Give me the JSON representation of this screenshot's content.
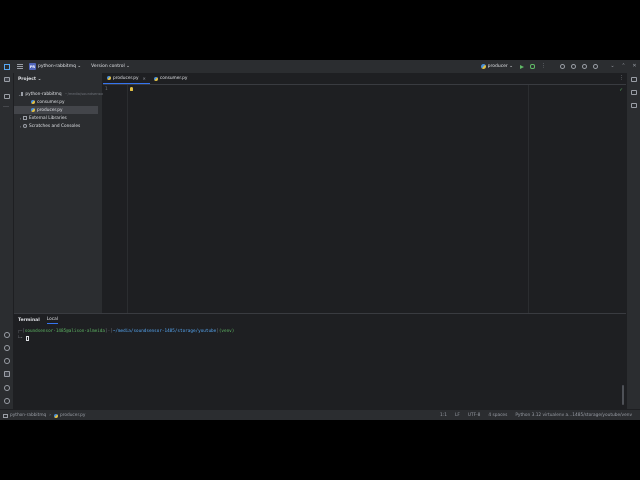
{
  "titlebar": {
    "project_badge": "PR",
    "project_name": "python-rabbitmq",
    "vcs_label": "Version control",
    "run_config": "producer"
  },
  "project_panel": {
    "title": "Project",
    "tree": [
      {
        "label": "python-rabbitmq",
        "path": "~/media/soundsensor-1485",
        "kind": "folder",
        "expanded": true,
        "depth": 0
      },
      {
        "label": "consumer.py",
        "kind": "python",
        "depth": 1
      },
      {
        "label": "producer.py",
        "kind": "python",
        "depth": 1,
        "selected": true
      },
      {
        "label": "External Libraries",
        "kind": "library",
        "depth": 0
      },
      {
        "label": "Scratches and Consoles",
        "kind": "scratch",
        "depth": 0
      }
    ]
  },
  "editor": {
    "tabs": [
      {
        "label": "producer.py",
        "active": true
      },
      {
        "label": "consumer.py",
        "active": false
      }
    ],
    "line_numbers": [
      "1"
    ]
  },
  "terminal": {
    "title": "Terminal",
    "tab": "Local",
    "prompt_user": "soundsensor-1485@alison-almeida",
    "prompt_path": "~/media/soundsensor-1485/storage/youtube",
    "prompt_env": "(venv)",
    "prompt_bracket_open": "[",
    "prompt_bracket_mid": "]-[",
    "prompt_bracket_close": "]",
    "prompt_prefix": "┌─",
    "prompt_second": "└╼"
  },
  "statusbar": {
    "crumbs": [
      "python-rabbitmq",
      "producer.py"
    ],
    "position": "1:1",
    "line_sep": "LF",
    "encoding": "UTF-8",
    "indent": "4 spaces",
    "interpreter": "Python 3.12 virtualenv a...1485/storage/youtube/venv"
  },
  "colors": {
    "accent": "#3574f0",
    "background": "#1e1f22",
    "panel": "#2b2d30",
    "terminal_green": "#5fb865",
    "terminal_blue": "#56a8f5"
  }
}
